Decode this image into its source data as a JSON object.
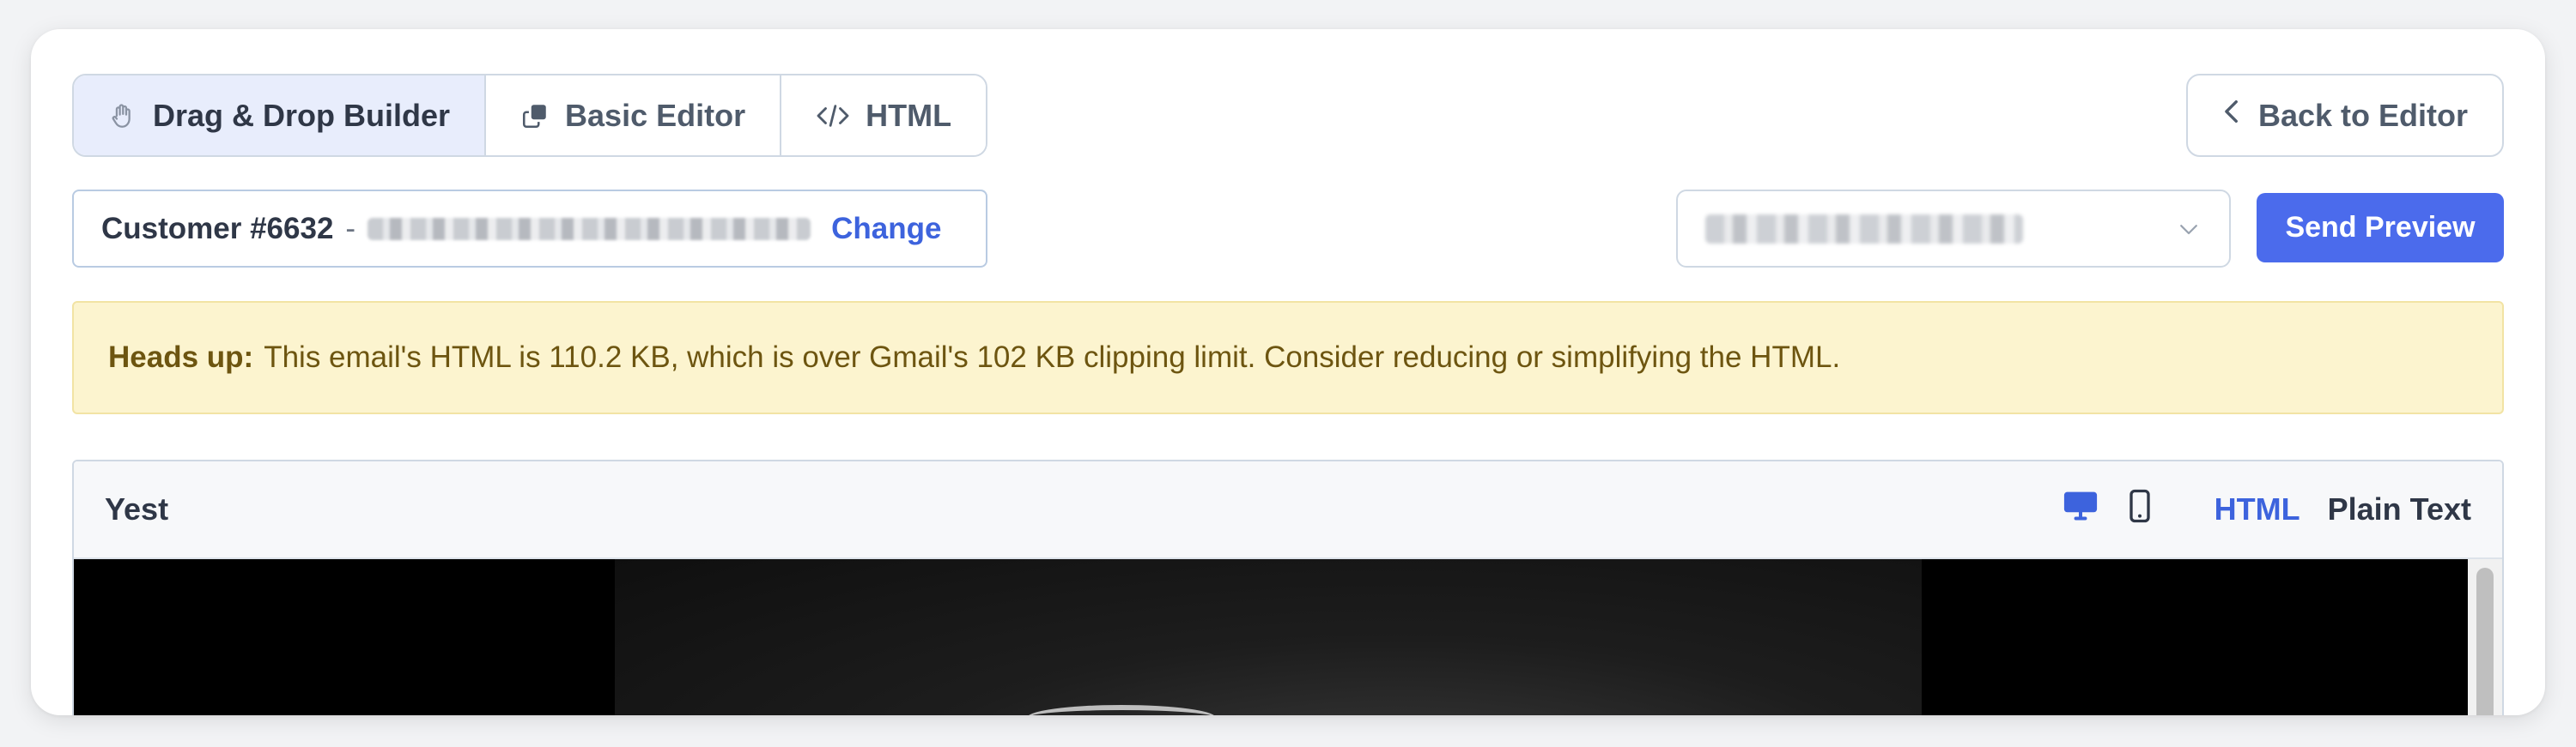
{
  "tabs": [
    {
      "label": "Drag & Drop Builder",
      "icon": "hand-icon",
      "active": true
    },
    {
      "label": "Basic Editor",
      "icon": "copy-icon",
      "active": false
    },
    {
      "label": "HTML",
      "icon": "code-icon",
      "active": false
    }
  ],
  "back_button": {
    "label": "Back to Editor",
    "icon": "chevron-left-icon"
  },
  "customer": {
    "label": "Customer #6632",
    "separator": "-",
    "change_label": "Change"
  },
  "send_preview": {
    "label": "Send Preview"
  },
  "banner": {
    "title": "Heads up:",
    "message": "This email's HTML is 110.2 KB, which is over Gmail's 102 KB clipping limit. Consider reducing or simplifying the HTML."
  },
  "preview": {
    "title": "Yest",
    "mode_html": "HTML",
    "mode_plain": "Plain Text",
    "device_desktop_icon": "desktop-icon",
    "device_mobile_icon": "mobile-icon"
  },
  "colors": {
    "accent": "#4b6bec",
    "link": "#3d63dd",
    "banner_bg": "#fcf4cf",
    "banner_text": "#6d5510"
  }
}
